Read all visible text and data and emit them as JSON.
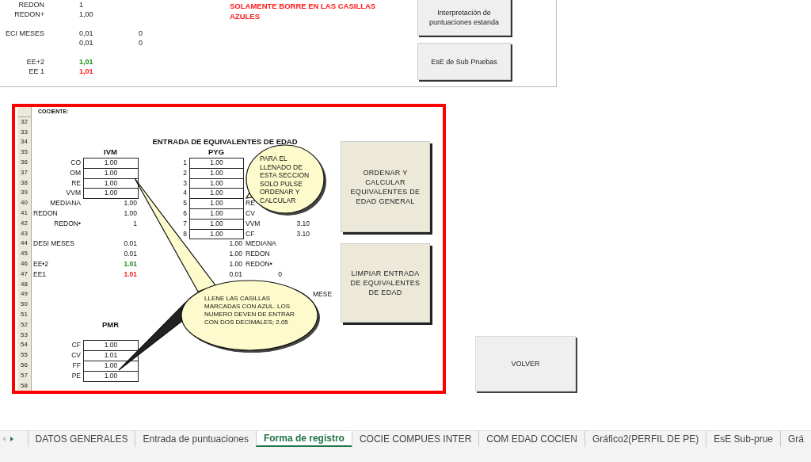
{
  "top_panel": {
    "rows": [
      {
        "label": "REDON",
        "value": "1"
      },
      {
        "label": "REDON+",
        "value": "1,00"
      },
      {},
      {
        "label": "ECI MESES",
        "value": "0,01",
        "extra": "0"
      },
      {
        "value": "0,01",
        "extra": "0"
      },
      {},
      {
        "label": "EE+2",
        "value": "1,01",
        "color": "#1e8c1e"
      },
      {
        "label": "EE 1",
        "value": "1,01",
        "color": "#ff1a1a"
      }
    ],
    "notice": "SOLAMENTE  BORRE EN LAS CASILLAS AZULES",
    "buttons": [
      "Interpretación de puntuaciones estanda",
      "EsE de Sub Pruebas"
    ]
  },
  "embedded_sheet": {
    "rows": [
      {
        "note": "COCIENTE:"
      },
      {
        "num": "32"
      },
      {
        "num": "33"
      },
      {
        "num": "34",
        "title": "ENTRADA DE EQUIVALENTES DE EDAD"
      },
      {
        "num": "35",
        "ivm_heading": "IVM",
        "pyg_heading": "PYG"
      },
      {
        "num": "36",
        "label": {
          "text": "CO",
          "kind": "right"
        },
        "ivm": {
          "text": "1.00",
          "kind": "input"
        },
        "pyg_no": "1",
        "pyg": {
          "text": "1.00",
          "kind": "input"
        }
      },
      {
        "num": "37",
        "label": {
          "text": "OM",
          "kind": "right"
        },
        "ivm": {
          "text": "1.00",
          "kind": "input"
        },
        "pyg_no": "2",
        "pyg": {
          "text": "1.00",
          "kind": "input"
        }
      },
      {
        "num": "38",
        "label": {
          "text": "RE",
          "kind": "right"
        },
        "ivm": {
          "text": "1.00",
          "kind": "input"
        },
        "pyg_no": "3",
        "pyg": {
          "text": "1.00",
          "kind": "input"
        }
      },
      {
        "num": "39",
        "label": {
          "text": "VVM",
          "kind": "right"
        },
        "ivm": {
          "text": "1.00",
          "kind": "input"
        },
        "pyg_no": "4",
        "pyg": {
          "text": "1.00",
          "kind": "input"
        }
      },
      {
        "num": "40",
        "label": {
          "text": "MEDIANA",
          "kind": "right"
        },
        "ivm": {
          "text": "1.00",
          "kind": "value"
        },
        "pyg_no": "5",
        "pyg": {
          "text": "1.00",
          "kind": "input"
        },
        "pyg_label": {
          "text": "RE",
          "kind": "left"
        }
      },
      {
        "num": "41",
        "label": {
          "text": "REDON",
          "kind": "left"
        },
        "ivm": {
          "text": "1.00",
          "kind": "value"
        },
        "pyg_no": "6",
        "pyg": {
          "text": "1.00",
          "kind": "input"
        },
        "pyg_label": {
          "text": "CV",
          "kind": "left"
        }
      },
      {
        "num": "42",
        "label": {
          "text": "REDON•",
          "kind": "right"
        },
        "ivm": {
          "text": "1",
          "kind": "value"
        },
        "pyg_no": "7",
        "pyg": {
          "text": "1.00",
          "kind": "input"
        },
        "pyg_label": {
          "text": "VVM",
          "kind": "left"
        },
        "pyg_value": "3.10"
      },
      {
        "num": "43",
        "pyg_no": "8",
        "pyg": {
          "text": "1.00",
          "kind": "input"
        },
        "pyg_label": {
          "text": "CF",
          "kind": "left"
        },
        "pyg_value": "3.10"
      },
      {
        "num": "44",
        "label": {
          "text": "DESI MESES",
          "kind": "left"
        },
        "ivm": {
          "text": "0.01",
          "kind": "value"
        },
        "pyg": {
          "text": "1.00",
          "kind": "value"
        },
        "pyg_label": {
          "text": "MEDIANA",
          "kind": "left"
        }
      },
      {
        "num": "45",
        "ivm": {
          "text": "0.01",
          "kind": "value"
        },
        "pyg": {
          "text": "1.00",
          "kind": "value"
        },
        "pyg_label": {
          "text": "REDON",
          "kind": "left"
        }
      },
      {
        "num": "46",
        "label": {
          "text": "EE•2",
          "kind": "left"
        },
        "ivm": {
          "text": "1.01",
          "kind": "value",
          "color": "#1e8c1e"
        },
        "pyg": {
          "text": "1.00",
          "kind": "value"
        },
        "pyg_label": {
          "text": "REDON•",
          "kind": "left"
        }
      },
      {
        "num": "47",
        "label": {
          "text": "EE1",
          "kind": "left"
        },
        "ivm": {
          "text": "1.01",
          "kind": "value",
          "color": "#ff1a1a"
        },
        "pyg": {
          "text": "0.01",
          "kind": "value"
        },
        "pyg_label": {
          "text": "0",
          "kind": "right"
        }
      },
      {
        "num": "48"
      },
      {
        "num": "49",
        "extra": "MESE"
      },
      {
        "num": "50"
      },
      {
        "num": "51"
      },
      {
        "num": "52",
        "ivm_heading": "PMR"
      },
      {
        "num": "53"
      },
      {
        "num": "54",
        "label": {
          "text": "CF",
          "kind": "right"
        },
        "ivm": {
          "text": "1.00",
          "kind": "input"
        }
      },
      {
        "num": "55",
        "label": {
          "text": "CV",
          "kind": "right"
        },
        "ivm": {
          "text": "1.01",
          "kind": "input"
        }
      },
      {
        "num": "56",
        "label": {
          "text": "FF",
          "kind": "right"
        },
        "ivm": {
          "text": "1.00",
          "kind": "input"
        }
      },
      {
        "num": "57",
        "label": {
          "text": "PE",
          "kind": "right"
        },
        "ivm": {
          "text": "1.00",
          "kind": "input"
        }
      },
      {
        "num": "58"
      }
    ],
    "callouts": [
      "PARA EL LLENADO DE ESTA SECCION SOLO PULSE ORDENAR Y CALCULAR",
      "LLENE LAS CASILLAS MARCADAS CON AZUL. LOS NUMERO DEVEN DE ENTRAR CON DOS DECIMALES; 2.05"
    ],
    "buttons": [
      "ORDENAR Y CALCULAR EQUIVALENTES DE EDAD GENERAL",
      "LIMPIAR ENTRADA DE EQUIVALENTES DE EDAD"
    ]
  },
  "back_button": "VOLVER",
  "sheet_tabs": [
    {
      "label": "DATOS GENERALES",
      "selected": false
    },
    {
      "label": "Entrada de puntuaciones",
      "selected": false
    },
    {
      "label": "Forma de registro",
      "selected": true
    },
    {
      "label": "COCIE COMPUES INTER",
      "selected": false
    },
    {
      "label": "COM EDAD COCIEN",
      "selected": false
    },
    {
      "label": "Gráfico2(PERFIL DE PE)",
      "selected": false
    },
    {
      "label": "EsE Sub-prue",
      "selected": false
    },
    {
      "label": "Grá",
      "selected": false
    }
  ]
}
